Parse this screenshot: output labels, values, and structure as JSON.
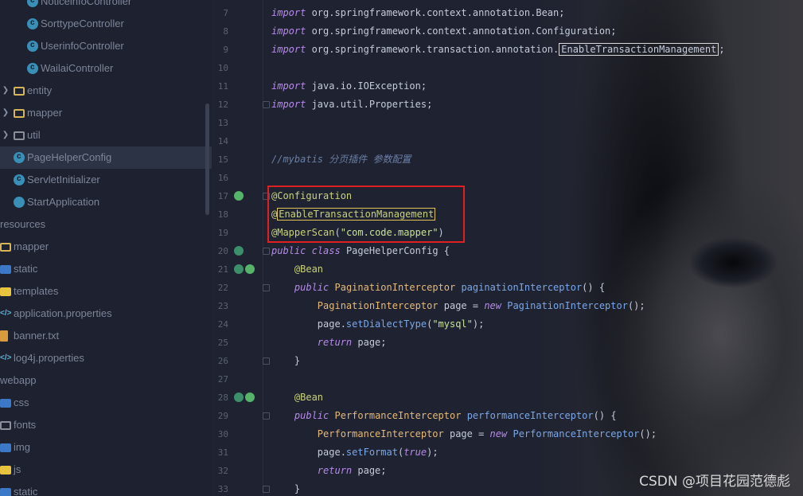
{
  "sidebar": {
    "items": [
      {
        "label": "NoticeinfoController",
        "icon": "class-icon"
      },
      {
        "label": "SorttypeController",
        "icon": "class-icon"
      },
      {
        "label": "UserinfoController",
        "icon": "class-icon"
      },
      {
        "label": "WailaiController",
        "icon": "class-icon"
      },
      {
        "label": "entity",
        "icon": "folder-icon"
      },
      {
        "label": "mapper",
        "icon": "folder-icon"
      },
      {
        "label": "util",
        "icon": "folder-icon"
      },
      {
        "label": "PageHelperConfig",
        "icon": "class-icon"
      },
      {
        "label": "ServletInitializer",
        "icon": "class-icon"
      },
      {
        "label": "StartApplication",
        "icon": "spring-boot-class-icon"
      },
      {
        "label": "resources",
        "icon": "none"
      },
      {
        "label": "mapper",
        "icon": "folder-icon"
      },
      {
        "label": "static",
        "icon": "folder-icon"
      },
      {
        "label": "templates",
        "icon": "folder-icon"
      },
      {
        "label": "application.properties",
        "icon": "properties-file-icon"
      },
      {
        "label": "banner.txt",
        "icon": "text-file-icon"
      },
      {
        "label": "log4j.properties",
        "icon": "properties-file-icon"
      },
      {
        "label": "webapp",
        "icon": "none"
      },
      {
        "label": "css",
        "icon": "folder-icon"
      },
      {
        "label": "fonts",
        "icon": "folder-icon"
      },
      {
        "label": "img",
        "icon": "folder-icon"
      },
      {
        "label": "js",
        "icon": "folder-icon"
      },
      {
        "label": "static",
        "icon": "folder-icon"
      }
    ]
  },
  "editor": {
    "lines": [
      {
        "n": "7",
        "text": "import org.springframework.context.annotation.Bean;"
      },
      {
        "n": "8",
        "text": "import org.springframework.context.annotation.Configuration;"
      },
      {
        "n": "9",
        "text": "import org.springframework.transaction.annotation.EnableTransactionManagement;"
      },
      {
        "n": "10",
        "text": ""
      },
      {
        "n": "11",
        "text": "import java.io.IOException;"
      },
      {
        "n": "12",
        "text": "import java.util.Properties;"
      },
      {
        "n": "13",
        "text": ""
      },
      {
        "n": "14",
        "text": ""
      },
      {
        "n": "15",
        "text": "//mybatis 分页插件 参数配置"
      },
      {
        "n": "16",
        "text": ""
      },
      {
        "n": "17",
        "text": "@Configuration"
      },
      {
        "n": "18",
        "text": "@EnableTransactionManagement"
      },
      {
        "n": "19",
        "text": "@MapperScan(\"com.code.mapper\")"
      },
      {
        "n": "20",
        "text": "public class PageHelperConfig {"
      },
      {
        "n": "21",
        "text": "    @Bean"
      },
      {
        "n": "22",
        "text": "    public PaginationInterceptor paginationInterceptor() {"
      },
      {
        "n": "23",
        "text": "        PaginationInterceptor page = new PaginationInterceptor();"
      },
      {
        "n": "24",
        "text": "        page.setDialectType(\"mysql\");"
      },
      {
        "n": "25",
        "text": "        return page;"
      },
      {
        "n": "26",
        "text": "    }"
      },
      {
        "n": "27",
        "text": ""
      },
      {
        "n": "28",
        "text": "    @Bean"
      },
      {
        "n": "29",
        "text": "    public PerformanceInterceptor performanceInterceptor() {"
      },
      {
        "n": "30",
        "text": "        PerformanceInterceptor page = new PerformanceInterceptor();"
      },
      {
        "n": "31",
        "text": "        page.setFormat(true);"
      },
      {
        "n": "32",
        "text": "        return page;"
      },
      {
        "n": "33",
        "text": "    }"
      }
    ]
  },
  "watermark": "CSDN @项目花园范德彪",
  "colors": {
    "highlight_box": "#e02020",
    "keyword": "#b58be8",
    "annotation": "#c9d27a",
    "string": "#c9e39a",
    "class_name": "#e5b97a",
    "method": "#7aa7e8"
  }
}
